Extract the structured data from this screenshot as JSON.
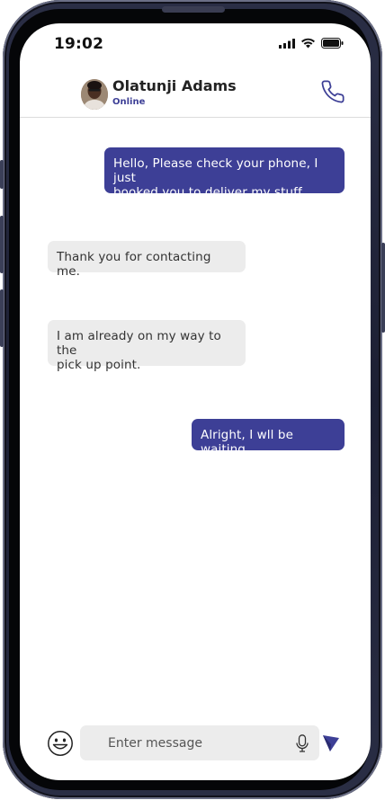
{
  "status_bar": {
    "time": "19:02",
    "icons": [
      "cellular-signal-icon",
      "wifi-icon",
      "battery-icon"
    ]
  },
  "header": {
    "contact_name": "Olatunji Adams",
    "contact_status": "Online",
    "call_icon": "phone-icon"
  },
  "messages": [
    {
      "direction": "outgoing",
      "lines": [
        "Hello, Please check your phone, I just",
        "booked you to deliver my stuff"
      ]
    },
    {
      "direction": "incoming",
      "lines": [
        "Thank you for contacting me."
      ]
    },
    {
      "direction": "incoming",
      "lines": [
        "I am already on my way to the",
        "pick up point."
      ]
    },
    {
      "direction": "outgoing",
      "lines": [
        "Alright, I wll be waiting"
      ]
    }
  ],
  "composer": {
    "placeholder": "Enter message",
    "value": "",
    "emoji_icon": "emoji-icon",
    "mic_icon": "microphone-icon",
    "send_icon": "send-icon"
  },
  "colors": {
    "accent": "#3d3f96",
    "incoming_bubble": "#ececec",
    "frame": "#1c1f33"
  }
}
